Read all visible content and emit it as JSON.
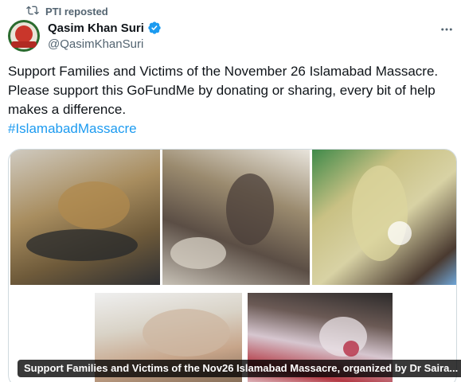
{
  "repost": {
    "icon": "repost-icon",
    "label": "PTI reposted"
  },
  "author": {
    "display_name": "Qasim Khan Suri",
    "handle": "@QasimKhanSuri",
    "verified": true,
    "verified_color": "#1d9bf0"
  },
  "tweet": {
    "lines": [
      "Support Families and Victims of the November 26 Islamabad Massacre.",
      "Please support this GoFundMe by donating or sharing, every bit of help",
      "makes a difference."
    ],
    "hashtag": "#IslamabadMassacre"
  },
  "media": {
    "photo_count": 5,
    "caption": "Support Families and Victims of the Nov26 Islamabad Massacre, organized by Dr Saira..."
  },
  "colors": {
    "text": "#0f1419",
    "secondary": "#536471",
    "link": "#1d9bf0",
    "border": "#cfd9de"
  }
}
